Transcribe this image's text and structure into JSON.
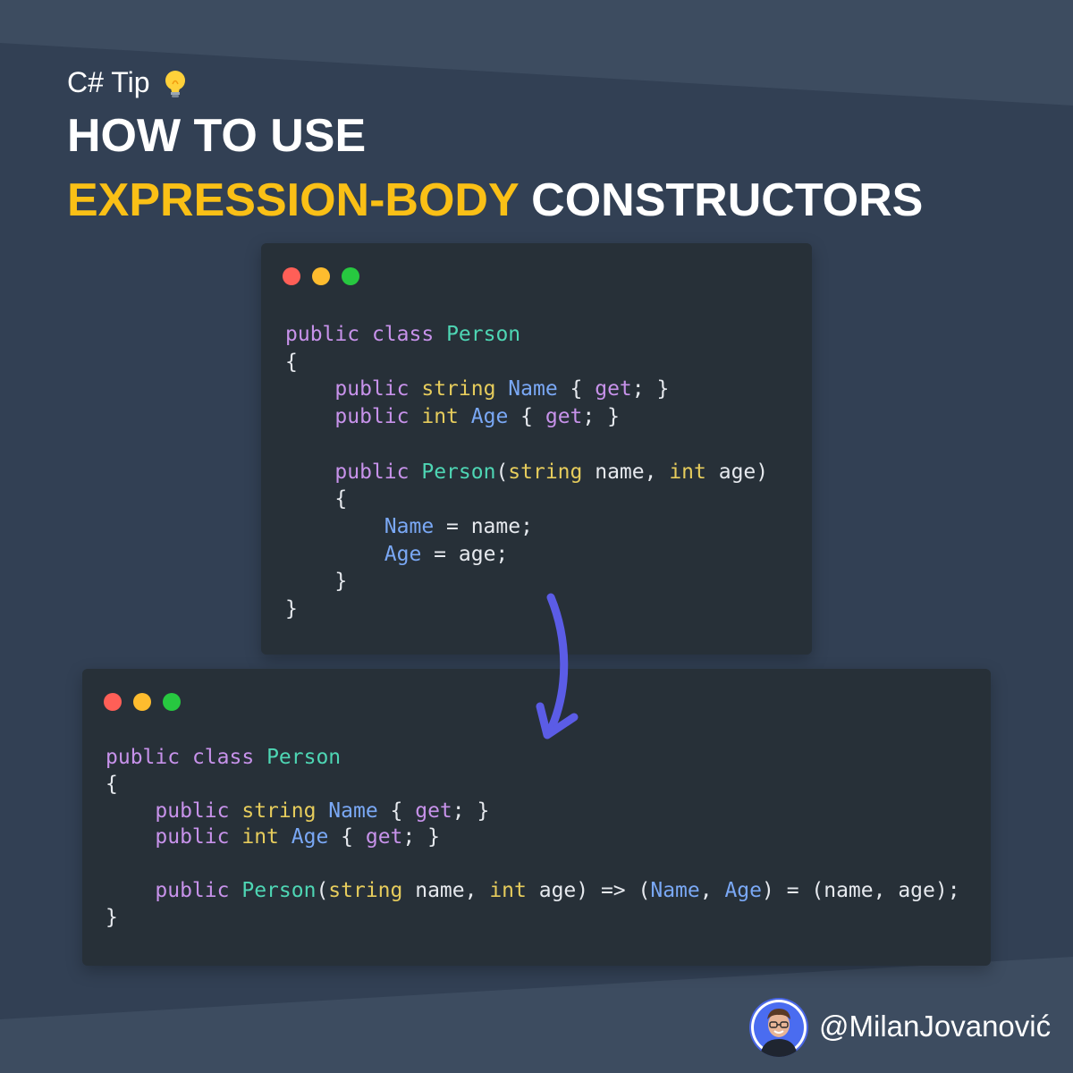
{
  "header": {
    "tip_label": "C# Tip",
    "title_line1": "HOW TO USE",
    "title_highlight": "EXPRESSION-BODY",
    "title_rest": "CONSTRUCTORS"
  },
  "colors": {
    "background": "#324054",
    "card": "#273038",
    "highlight": "#fac016",
    "arrow": "#5b5ce6",
    "keyword": "#c792ea",
    "type": "#e6cc5c",
    "class_name": "#4ed6b4",
    "property": "#7aa8f5"
  },
  "icons": {
    "tip": "lightbulb-icon",
    "window_controls": [
      "close-dot",
      "minimize-dot",
      "maximize-dot"
    ],
    "transition": "curved-arrow-down-icon"
  },
  "code_before": {
    "lines": [
      [
        [
          "kw",
          "public"
        ],
        [
          "p",
          " "
        ],
        [
          "kw",
          "class"
        ],
        [
          "p",
          " "
        ],
        [
          "cls",
          "Person"
        ]
      ],
      [
        [
          "p",
          "{"
        ]
      ],
      [
        [
          "p",
          "    "
        ],
        [
          "kw",
          "public"
        ],
        [
          "p",
          " "
        ],
        [
          "ty",
          "string"
        ],
        [
          "p",
          " "
        ],
        [
          "prop",
          "Name"
        ],
        [
          "p",
          " { "
        ],
        [
          "kw",
          "get"
        ],
        [
          "p",
          "; }"
        ]
      ],
      [
        [
          "p",
          "    "
        ],
        [
          "kw",
          "public"
        ],
        [
          "p",
          " "
        ],
        [
          "ty",
          "int"
        ],
        [
          "p",
          " "
        ],
        [
          "prop",
          "Age"
        ],
        [
          "p",
          " { "
        ],
        [
          "kw",
          "get"
        ],
        [
          "p",
          "; }"
        ]
      ],
      [
        [
          "p",
          ""
        ]
      ],
      [
        [
          "p",
          "    "
        ],
        [
          "kw",
          "public"
        ],
        [
          "p",
          " "
        ],
        [
          "cls",
          "Person"
        ],
        [
          "p",
          "("
        ],
        [
          "ty",
          "string"
        ],
        [
          "p",
          " name, "
        ],
        [
          "ty",
          "int"
        ],
        [
          "p",
          " age)"
        ]
      ],
      [
        [
          "p",
          "    {"
        ]
      ],
      [
        [
          "p",
          "        "
        ],
        [
          "prop",
          "Name"
        ],
        [
          "p",
          " = name;"
        ]
      ],
      [
        [
          "p",
          "        "
        ],
        [
          "prop",
          "Age"
        ],
        [
          "p",
          " = age;"
        ]
      ],
      [
        [
          "p",
          "    }"
        ]
      ],
      [
        [
          "p",
          "}"
        ]
      ]
    ]
  },
  "code_after": {
    "lines": [
      [
        [
          "kw",
          "public"
        ],
        [
          "p",
          " "
        ],
        [
          "kw",
          "class"
        ],
        [
          "p",
          " "
        ],
        [
          "cls",
          "Person"
        ]
      ],
      [
        [
          "p",
          "{"
        ]
      ],
      [
        [
          "p",
          "    "
        ],
        [
          "kw",
          "public"
        ],
        [
          "p",
          " "
        ],
        [
          "ty",
          "string"
        ],
        [
          "p",
          " "
        ],
        [
          "prop",
          "Name"
        ],
        [
          "p",
          " { "
        ],
        [
          "kw",
          "get"
        ],
        [
          "p",
          "; }"
        ]
      ],
      [
        [
          "p",
          "    "
        ],
        [
          "kw",
          "public"
        ],
        [
          "p",
          " "
        ],
        [
          "ty",
          "int"
        ],
        [
          "p",
          " "
        ],
        [
          "prop",
          "Age"
        ],
        [
          "p",
          " { "
        ],
        [
          "kw",
          "get"
        ],
        [
          "p",
          "; }"
        ]
      ],
      [
        [
          "p",
          ""
        ]
      ],
      [
        [
          "p",
          "    "
        ],
        [
          "kw",
          "public"
        ],
        [
          "p",
          " "
        ],
        [
          "cls",
          "Person"
        ],
        [
          "p",
          "("
        ],
        [
          "ty",
          "string"
        ],
        [
          "p",
          " name, "
        ],
        [
          "ty",
          "int"
        ],
        [
          "p",
          " age) => ("
        ],
        [
          "prop",
          "Name"
        ],
        [
          "p",
          ", "
        ],
        [
          "prop",
          "Age"
        ],
        [
          "p",
          ") = (name, age);"
        ]
      ],
      [
        [
          "p",
          "}"
        ]
      ]
    ]
  },
  "footer": {
    "handle": "@MilanJovanović",
    "avatar_icon": "avatar-icon"
  }
}
